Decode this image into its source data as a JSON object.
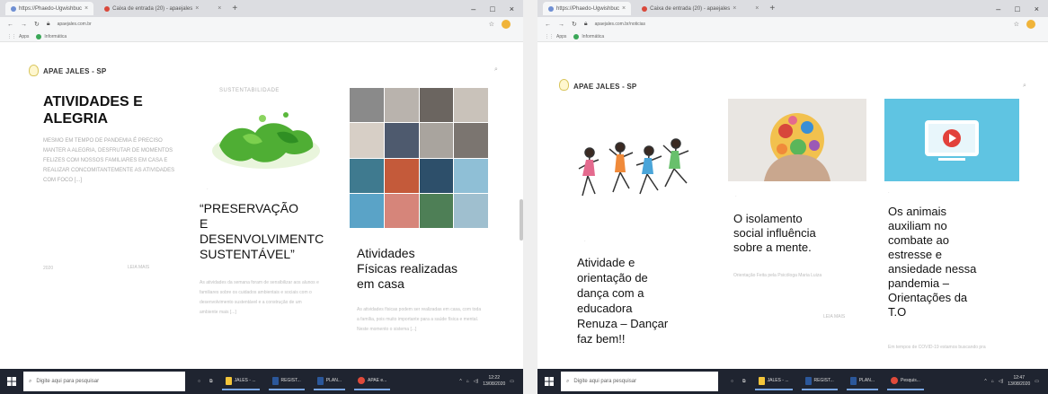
{
  "left": {
    "tabs": [
      {
        "label": "https://Phaedo-Ugwishbuc",
        "active": true
      },
      {
        "label": "Caixa de entrada (20) - apaejales",
        "active": false
      },
      {
        "label": "",
        "active": false
      }
    ],
    "url": "apaejales.com.br",
    "bookmarks": [
      "Apps",
      "Informática"
    ],
    "site_title": "APAE JALES - SP",
    "hero": {
      "title": "ATIVIDADES E ALEGRIA",
      "text": "MESMO EM TEMPO DE PANDEMIA É PRECISO MANTER A ALEGRIA, DESFRUTAR DE MOMENTOS FELIZES COM NOSSOS FAMILIARES EM CASA E REALIZAR CONCOMITANTEMENTE AS ATIVIDADES COM FOCO [...]",
      "date": "2020",
      "more": "LEIA MAIS"
    },
    "posts": [
      {
        "tagline": "SUSTENTABILIDADE",
        "title_lines": [
          "“PRESERVAÇÃO",
          "E",
          "DESENVOLVIMENTC",
          "SUSTENTÁVEL”"
        ],
        "excerpt": "As atividades da semana foram de sensibilizar aos alunos e familiares sobre os cuidados ambientais e sociais com o desenvolvimento sustentável e a construção de um ambiente mais [...]"
      },
      {
        "tagline": "",
        "title_lines": [
          "Atividades",
          "Físicas realizadas",
          "em casa"
        ],
        "excerpt": "As atividades físicas podem ser realizadas em casa, com toda a família, pois muito importante para a saúde física e mental. Neste momento o sistema [...]"
      }
    ],
    "taskbar": {
      "search": "Digite aqui para pesquisar",
      "apps": [
        "JALES - ...",
        "REGIST...",
        "PLAN...",
        "APAE e..."
      ],
      "time": "12:22",
      "date": "13/08/2020"
    }
  },
  "right": {
    "tabs": [
      {
        "label": "https://Phaedo-Ugwishbuc",
        "active": true
      },
      {
        "label": "Caixa de entrada (20) - apaejales",
        "active": false
      },
      {
        "label": "",
        "active": false
      }
    ],
    "url": "apaejales.com.br/noticias",
    "bookmarks": [
      "Apps",
      "Informática"
    ],
    "site_title": "APAE JALES - SP",
    "posts": [
      {
        "title_lines": [
          "Atividade e",
          "orientação de",
          "dança com a",
          "educadora",
          "Renuza – Dançar",
          "faz bem!!"
        ],
        "excerpt": ""
      },
      {
        "title_lines": [
          "O isolamento",
          "social influência",
          "sobre a mente."
        ],
        "excerpt": "Orientação Feita pela Psicóloga Maria Luiza",
        "more": "LEIA MAIS"
      },
      {
        "title_lines": [
          "Os animais",
          "auxiliam no",
          "combate ao",
          "estresse e",
          "ansiedade nessa",
          "pandemia –",
          "Orientações da",
          "T.O"
        ],
        "excerpt": "Em tempos de COVID-19 estamos buscando pra"
      }
    ],
    "taskbar": {
      "search": "Digite aqui para pesquisar",
      "apps": [
        "JALES - ...",
        "REGIST...",
        "PLAN...",
        "Pesquis..."
      ],
      "time": "12:47",
      "date": "13/08/2020"
    }
  },
  "icons": [
    "back-arrow-icon",
    "forward-arrow-icon",
    "reload-icon",
    "lock-icon",
    "star-icon",
    "windows-start-icon",
    "search-icon",
    "file-explorer-icon",
    "chrome-icon",
    "notification-icon"
  ],
  "colors": {
    "taskbar": "#1f2430",
    "accent": "#7aa7e4"
  }
}
